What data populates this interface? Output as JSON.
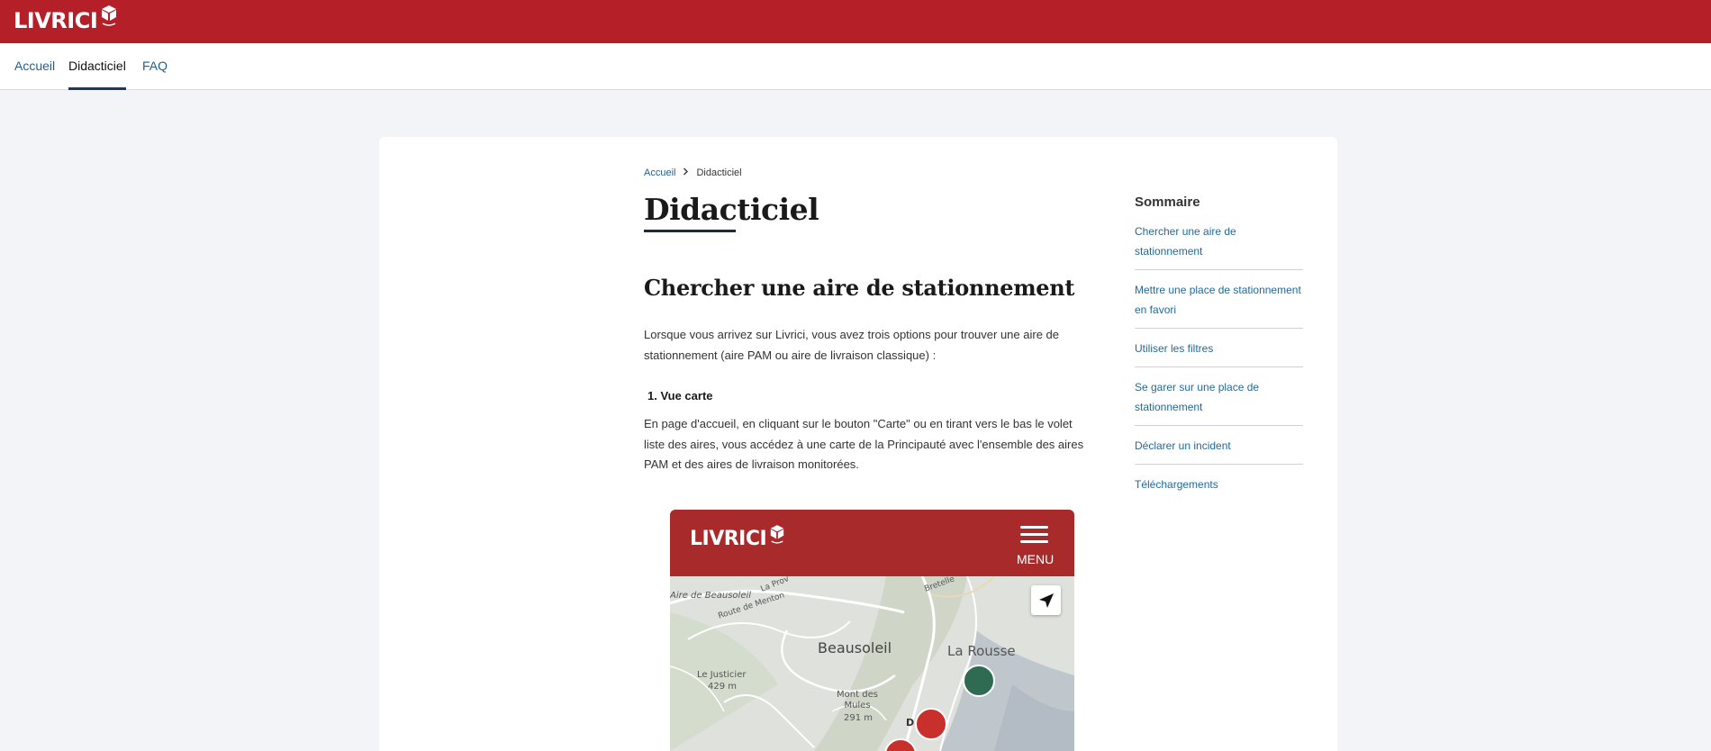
{
  "app": {
    "brand": "LIVRICI"
  },
  "nav": {
    "items": [
      {
        "label": "Accueil"
      },
      {
        "label": "Didacticiel"
      },
      {
        "label": "FAQ"
      }
    ]
  },
  "breadcrumb": {
    "home": "Accueil",
    "current": "Didacticiel"
  },
  "page": {
    "title": "Didacticiel",
    "section_title": "Chercher une aire de stationnement",
    "intro": "Lorsque vous arrivez sur Livrici, vous avez trois options pour trouver une aire de stationnement (aire PAM ou aire de livraison classique) :",
    "step1_label": "1. Vue carte",
    "step1_text": "En page d'accueil, en cliquant sur le bouton \"Carte\" ou en tirant vers le bas le volet liste des aires, vous accédez à une carte de la Principauté avec l'ensemble des aires PAM et des aires de livraison monitorées."
  },
  "sommaire": {
    "title": "Sommaire",
    "items": [
      {
        "label": "Chercher une aire de stationnement"
      },
      {
        "label": "Mettre une place de stationnement en favori"
      },
      {
        "label": "Utiliser les filtres"
      },
      {
        "label": "Se garer sur une place de stationnement"
      },
      {
        "label": "Déclarer un incident"
      },
      {
        "label": "Téléchargements"
      }
    ]
  },
  "phone": {
    "brand": "LIVRICI",
    "menu_label": "MENU",
    "map_labels": {
      "town": "Beausoleil",
      "district": "La Rousse",
      "aire": "Aire de Beausoleil",
      "road1": "Route de Menton",
      "road2": "La Prov",
      "road3": "Bretelle",
      "peak1_name": "Le Justicier",
      "peak1_alt": "429 m",
      "peak2_name": "Mont des Mules",
      "peak2_alt": "291 m",
      "marker_letter": "D"
    }
  },
  "colors": {
    "topbar": "#b51f27",
    "link": "#1f5f8b",
    "marker_green": "#2e6b52",
    "marker_red": "#c9302c"
  }
}
